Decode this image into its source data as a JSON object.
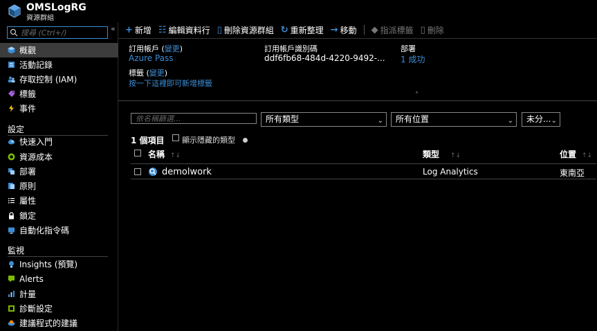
{
  "header": {
    "title": "OMSLogRG",
    "subtitle": "資源群組",
    "logo_icon": "resource-group-cube-icon"
  },
  "sidebar": {
    "search_placeholder": "搜尋 (Ctrl+/)",
    "collapse_glyph": "«",
    "items_top": [
      {
        "label": "概觀",
        "icon": "overview-cube-icon",
        "active": true,
        "color": "#3b8dd6"
      },
      {
        "label": "活動記錄",
        "icon": "activity-log-icon",
        "color": "#3b8dd6"
      },
      {
        "label": "存取控制 (IAM)",
        "icon": "iam-people-icon",
        "color": "#3b8dd6"
      },
      {
        "label": "標籤",
        "icon": "tag-icon",
        "color": "#a55fd8"
      },
      {
        "label": "事件",
        "icon": "lightning-icon",
        "color": "#f5c400"
      }
    ],
    "section_settings": "設定",
    "items_settings": [
      {
        "label": "快速入門",
        "icon": "quickstart-cloud-icon",
        "color": "#3b8dd6"
      },
      {
        "label": "資源成本",
        "icon": "cost-circle-icon",
        "color": "#7cbb00"
      },
      {
        "label": "部署",
        "icon": "deployment-icon",
        "color": "#3b8dd6"
      },
      {
        "label": "原則",
        "icon": "policy-icon",
        "color": "#3b8dd6"
      },
      {
        "label": "屬性",
        "icon": "properties-list-icon",
        "color": "#ffffff"
      },
      {
        "label": "鎖定",
        "icon": "lock-icon",
        "color": "#ffffff"
      },
      {
        "label": "自動化指令碼",
        "icon": "automation-script-icon",
        "color": "#3b8dd6"
      }
    ],
    "section_monitoring": "監視",
    "items_monitoring": [
      {
        "label": "Insights (預覽)",
        "icon": "insights-bulb-icon",
        "color": "#3b8dd6"
      },
      {
        "label": "Alerts",
        "icon": "alerts-bell-icon",
        "color": "#7cbb00"
      },
      {
        "label": "計量",
        "icon": "metrics-chart-icon",
        "color": "#3b8dd6"
      },
      {
        "label": "診斷設定",
        "icon": "diagnostics-icon",
        "color": "#7cbb00"
      },
      {
        "label": "建議程式的建議",
        "icon": "advisor-icon",
        "color": "#3b8dd6"
      }
    ]
  },
  "toolbar": {
    "add": "新增",
    "edit_columns": "編輯資料行",
    "delete_group": "刪除資源群組",
    "refresh": "重新整理",
    "move": "移動",
    "assign_tags": "指派標籤",
    "delete": "刪除"
  },
  "essentials": {
    "subscription_label_prefix": "訂用帳戶 (",
    "subscription_change": "變更",
    "subscription_label_suffix": ")",
    "subscription_value": "Azure Pass",
    "subscription_id_label": "訂用帳戶識別碼",
    "subscription_id_value": "ddf6fb68-484d-4220-9492-...",
    "deployments_label": "部署",
    "deployments_value": "1 成功",
    "tags_label_prefix": "標籤 (",
    "tags_change": "變更",
    "tags_label_suffix": ")",
    "tags_add_link": "按一下這裡即可新增標籤",
    "collapse_glyph": "˄"
  },
  "filters": {
    "name_placeholder": "依名稱篩選...",
    "type_value": "所有類型",
    "location_value": "所有位置",
    "group_value": "未分..."
  },
  "list": {
    "count": "1 個項目",
    "show_hidden": "顯示隱藏的類型",
    "col_name": "名稱",
    "col_type": "類型",
    "col_location": "位置",
    "sort_glyph": "↑↓",
    "rows": [
      {
        "name": "demolwork",
        "type": "Log Analytics",
        "location": "東南亞",
        "icon": "log-analytics-icon"
      }
    ]
  },
  "colors": {
    "accent": "#3b8dd6",
    "active_bg": "#3c3c3c"
  }
}
